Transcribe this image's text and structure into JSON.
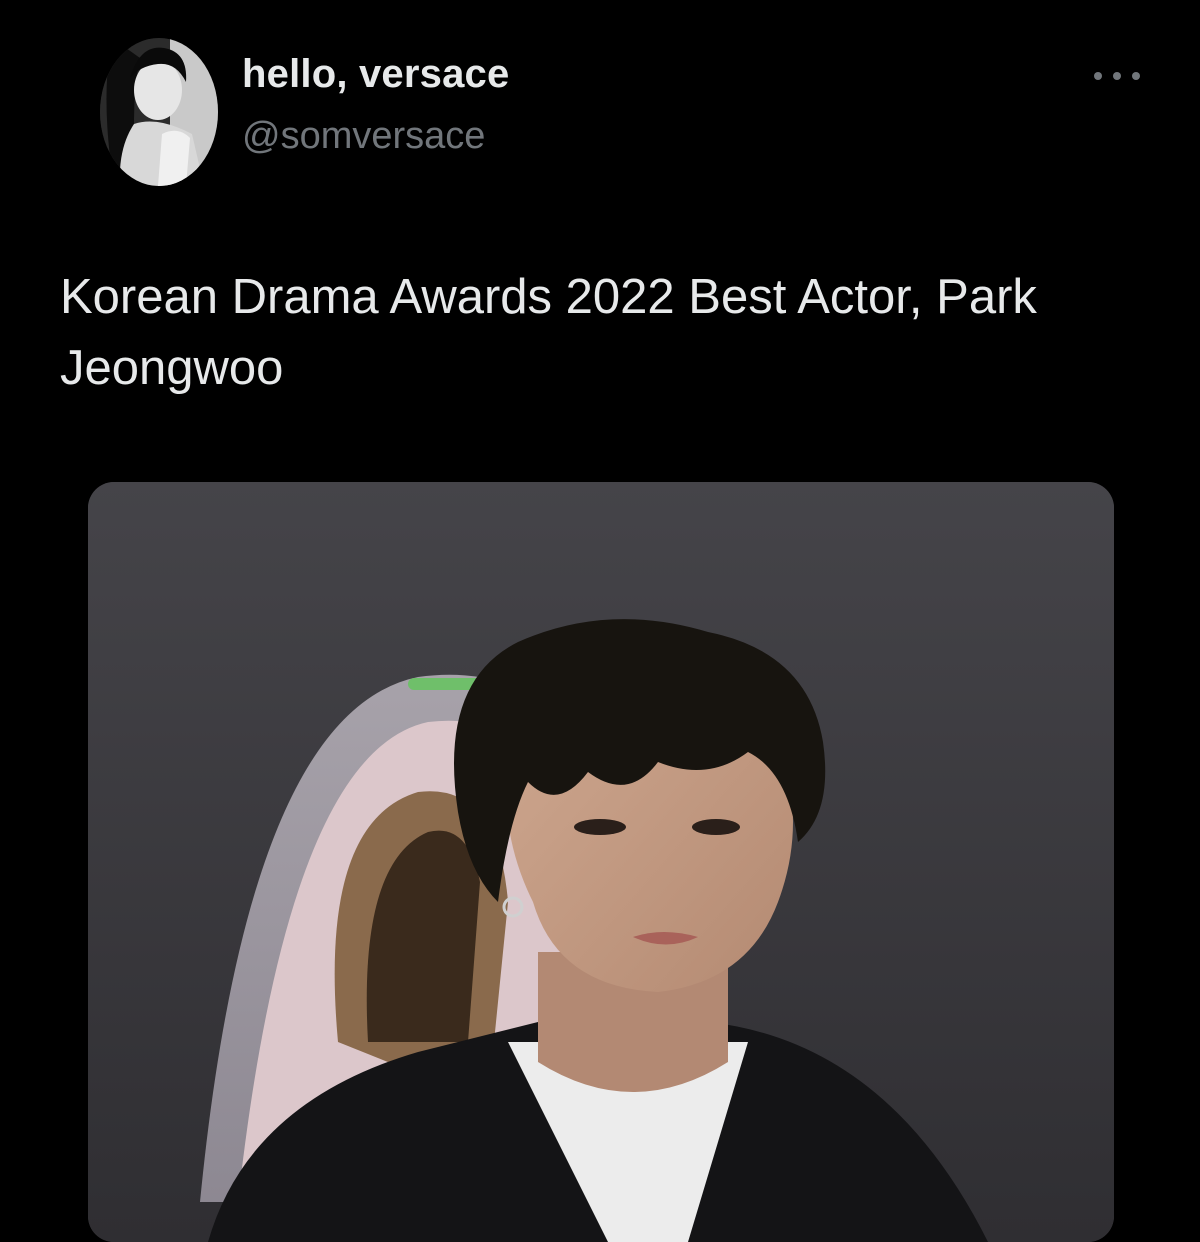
{
  "tweet": {
    "author": {
      "display_name": "hello, versace",
      "handle": "@somversace"
    },
    "text": "Korean Drama Awards 2022 Best Actor, Park Jeongwoo",
    "more_icon": "more-horizontal-icon",
    "media": {
      "type": "photo"
    }
  },
  "colors": {
    "background": "#000000",
    "primary_text": "#e7e9ea",
    "secondary_text": "#71767b"
  }
}
